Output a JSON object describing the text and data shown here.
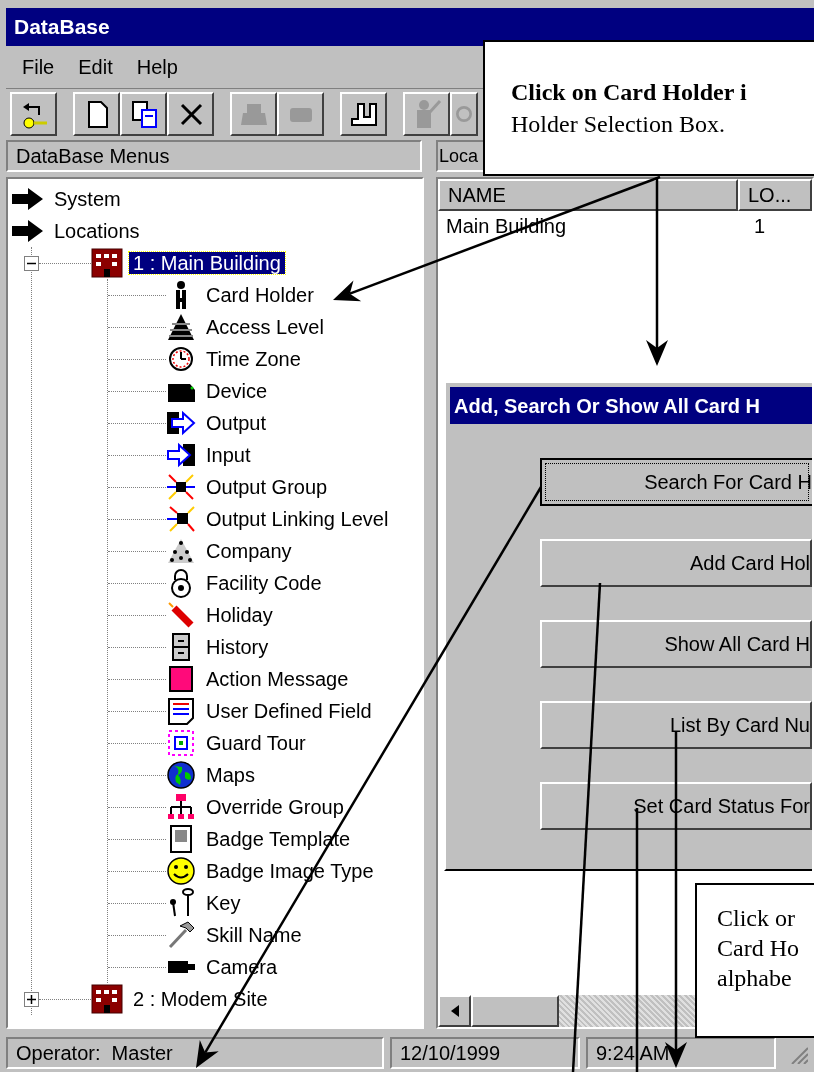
{
  "window": {
    "title": "DataBase"
  },
  "menu": [
    "File",
    "Edit",
    "Help"
  ],
  "toolbar": [
    {
      "disabled": false
    },
    {
      "disabled": false
    },
    {
      "disabled": false
    },
    {
      "disabled": false
    },
    {
      "disabled": true
    },
    {
      "disabled": true
    },
    {
      "disabled": false
    },
    {
      "disabled": true
    },
    {
      "disabled": true
    }
  ],
  "left_panel": {
    "header": "DataBase Menus"
  },
  "tree": [
    {
      "label": "System",
      "selected": false
    },
    {
      "label": "Locations",
      "selected": false,
      "children": [
        {
          "label": "1 : Main Building",
          "selected": true,
          "expanded": true,
          "children": [
            {
              "label": "Card Holder",
              "selected": false
            },
            {
              "label": "Access Level",
              "selected": false
            },
            {
              "label": "Time Zone",
              "selected": false
            },
            {
              "label": "Device",
              "selected": false
            },
            {
              "label": "Output",
              "selected": false
            },
            {
              "label": "Input",
              "selected": false
            },
            {
              "label": "Output Group",
              "selected": false
            },
            {
              "label": "Output Linking Level",
              "selected": false
            },
            {
              "label": "Company",
              "selected": false
            },
            {
              "label": "Facility Code",
              "selected": false
            },
            {
              "label": "Holiday",
              "selected": false
            },
            {
              "label": "History",
              "selected": false
            },
            {
              "label": "Action Message",
              "selected": false
            },
            {
              "label": "User Defined Field",
              "selected": false
            },
            {
              "label": "Guard Tour",
              "selected": false
            },
            {
              "label": "Maps",
              "selected": false
            },
            {
              "label": "Override Group",
              "selected": false
            },
            {
              "label": "Badge Template",
              "selected": false
            },
            {
              "label": "Badge Image Type",
              "selected": false
            },
            {
              "label": "Key",
              "selected": false
            },
            {
              "label": "Skill Name",
              "selected": false
            },
            {
              "label": "Camera",
              "selected": false
            }
          ]
        },
        {
          "label": "2 : Modem Site",
          "selected": false,
          "expanded": false
        }
      ]
    }
  ],
  "right_panel": {
    "header": "Loca",
    "table": {
      "columns": [
        "NAME",
        "LO..."
      ],
      "rows": [
        [
          "Main Building",
          "1"
        ]
      ]
    }
  },
  "dialog": {
    "title": "Add, Search Or Show All Card H",
    "buttons": [
      {
        "label": "Search For Card H",
        "focused": true
      },
      {
        "label": "Add Card Hol",
        "focused": false
      },
      {
        "label": "Show All Card H",
        "focused": false
      },
      {
        "label": "List By Card Nu",
        "focused": false
      },
      {
        "label": "Set Card Status For",
        "focused": false
      }
    ]
  },
  "status_bar": [
    "Operator:  Master",
    "12/10/1999",
    "9:24 AM"
  ],
  "callouts": [
    "**Click on Card Holder i**\nHolder Selection Box.",
    "Click or\nCard Ho\nalphabe"
  ]
}
